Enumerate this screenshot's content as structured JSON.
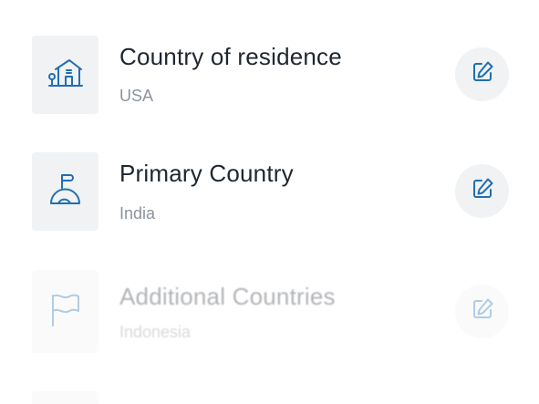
{
  "items": [
    {
      "title": "Country of residence",
      "value": "USA",
      "icon": "residence-house-icon",
      "action_icon": "edit-icon"
    },
    {
      "title": "Primary Country",
      "value": "India",
      "icon": "pin-location-icon",
      "action_icon": "edit-icon"
    },
    {
      "title": "Additional Countries",
      "value": "Indonesia",
      "icon": "flag-icon",
      "action_icon": "edit-icon",
      "state": "faded"
    }
  ],
  "colors": {
    "accent": "#1f6fb2",
    "title": "#1f2630",
    "subtitle": "#8c929c",
    "tile": "#f1f2f4"
  }
}
